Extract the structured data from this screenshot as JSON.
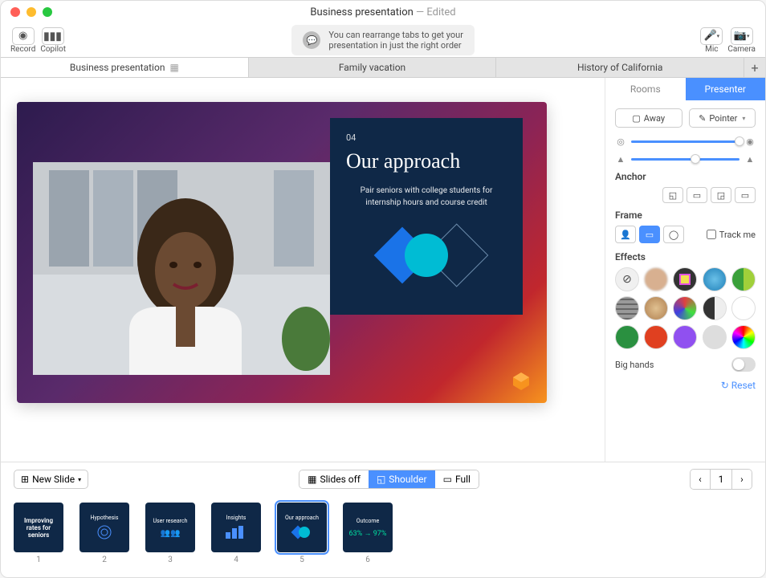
{
  "window": {
    "title": "Business presentation",
    "edited_suffix": " — Edited"
  },
  "toolbar": {
    "record_label": "Record",
    "copilot_label": "Copilot",
    "hint_line1": "You can rearrange tabs to get your",
    "hint_line2": "presentation in just the right order",
    "mic_label": "Mic",
    "camera_label": "Camera"
  },
  "tabs": {
    "items": [
      {
        "label": "Business presentation",
        "active": true
      },
      {
        "label": "Family vacation",
        "active": false
      },
      {
        "label": "History of California",
        "active": false
      }
    ]
  },
  "slide": {
    "number": "04",
    "title": "Our approach",
    "subtitle": "Pair seniors with college students for internship hours and course credit"
  },
  "sidebar": {
    "tab_rooms": "Rooms",
    "tab_presenter": "Presenter",
    "away_label": "Away",
    "pointer_label": "Pointer",
    "anchor_label": "Anchor",
    "frame_label": "Frame",
    "track_me_label": "Track me",
    "effects_label": "Effects",
    "big_hands_label": "Big hands",
    "reset_label": "Reset",
    "effect_colors": [
      "#e8e8e8",
      "#d8b090",
      "#f0e050",
      "#3aa0d8",
      "#3aa03a",
      "#888",
      "#c8a070",
      "#b090d8",
      "#555",
      "#fff",
      "#2a9040",
      "#e04020",
      "#9050f0"
    ]
  },
  "bottombar": {
    "new_slide_label": "New Slide",
    "view_slides_off": "Slides off",
    "view_shoulder": "Shoulder",
    "view_full": "Full",
    "page_number": "1"
  },
  "thumbnails": [
    {
      "title": "Improving rates for seniors",
      "n": "1"
    },
    {
      "title": "Hypothesis",
      "n": "2"
    },
    {
      "title": "User research",
      "n": "3"
    },
    {
      "title": "Insights",
      "n": "4"
    },
    {
      "title": "Our approach",
      "n": "5",
      "selected": true
    },
    {
      "title": "Outcome",
      "n": "6"
    }
  ]
}
